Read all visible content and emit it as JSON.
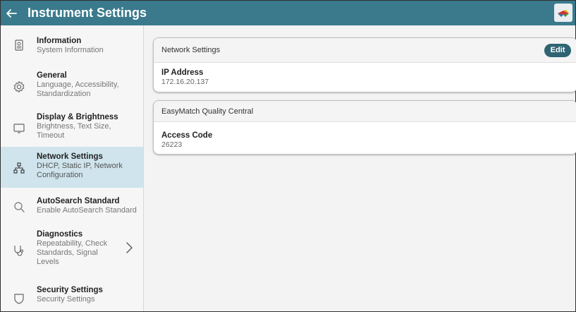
{
  "header": {
    "title": "Instrument Settings",
    "back_icon": "arrow-left-icon",
    "logo_icon": "app-logo-icon",
    "color": "#3a7a8c"
  },
  "sidebar": {
    "active_color": "#cfe4ec",
    "items": [
      {
        "title": "Information",
        "subtitle": "System Information",
        "icon": "badge-icon"
      },
      {
        "title": "General",
        "subtitle": "Language, Accessibility, Standardization",
        "icon": "gear-icon"
      },
      {
        "title": "Display & Brightness",
        "subtitle": "Brightness, Text Size, Timeout",
        "icon": "monitor-icon"
      },
      {
        "title": "Network Settings",
        "subtitle": "DHCP, Static IP, Network Configuration",
        "icon": "network-icon",
        "active": true
      },
      {
        "title": "AutoSearch Standard",
        "subtitle": "Enable AutoSearch Standard",
        "icon": "search-icon"
      },
      {
        "title": "Diagnostics",
        "subtitle": "Repeatability, Check Standards, Signal Levels",
        "icon": "stethoscope-icon",
        "has_chevron": true
      },
      {
        "title": "Security Settings",
        "subtitle": "Security Settings",
        "icon": "shield-icon"
      }
    ]
  },
  "main": {
    "network_card": {
      "title": "Network Settings",
      "edit_label": "Edit",
      "field_label": "IP Address",
      "field_value": "172.16.20.137"
    },
    "easymatch_card": {
      "title": "EasyMatch Quality Central",
      "field_label": "Access Code",
      "field_value": "26223"
    }
  }
}
